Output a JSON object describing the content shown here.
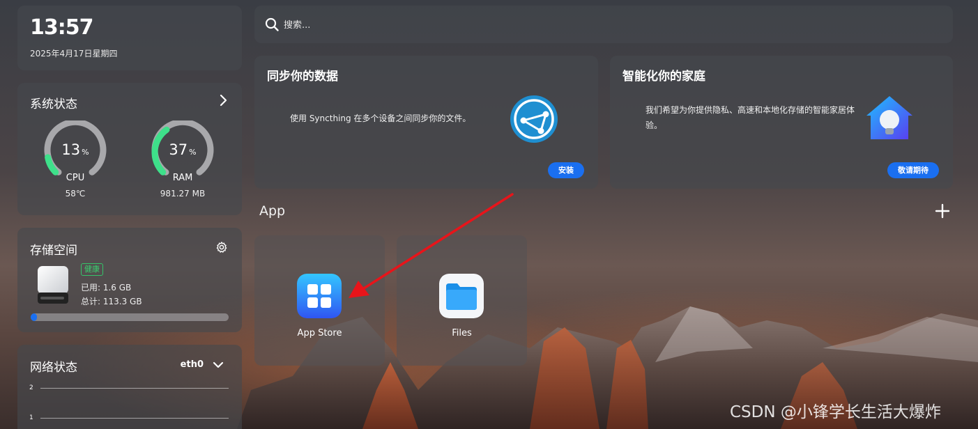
{
  "clock": {
    "time": "13:57",
    "date": "2025年4月17日星期四"
  },
  "system_status": {
    "title": "系统状态",
    "cpu": {
      "percent": 13,
      "unit": "%",
      "label": "CPU",
      "sub": "58℃"
    },
    "ram": {
      "percent": 37,
      "unit": "%",
      "label": "RAM",
      "sub": "981.27 MB"
    }
  },
  "storage": {
    "title": "存储空间",
    "badge": "健康",
    "used": "已用: 1.6 GB",
    "total": "总计: 113.3 GB",
    "used_fraction": 0.014
  },
  "network": {
    "title": "网络状态",
    "interface": "eth0",
    "y_ticks": [
      "2",
      "1"
    ]
  },
  "search": {
    "placeholder": "搜索..."
  },
  "promos": [
    {
      "title": "同步你的数据",
      "desc": "使用 Syncthing 在多个设备之间同步你的文件。",
      "button": "安装"
    },
    {
      "title": "智能化你的家庭",
      "desc": "我们希望为你提供隐私、高速和本地化存储的智能家居体验。",
      "button": "敬请期待"
    }
  ],
  "apps": {
    "heading": "App",
    "items": [
      {
        "name": "App Store",
        "icon": "app-store-icon"
      },
      {
        "name": "Files",
        "icon": "folder-icon"
      }
    ]
  },
  "colors": {
    "accent": "#1a6ff0",
    "gauge_green": "#3ee08a",
    "healthy": "#39d06f",
    "annotation_arrow": "#e8141a"
  },
  "watermark": "CSDN @小锋学长生活大爆炸"
}
